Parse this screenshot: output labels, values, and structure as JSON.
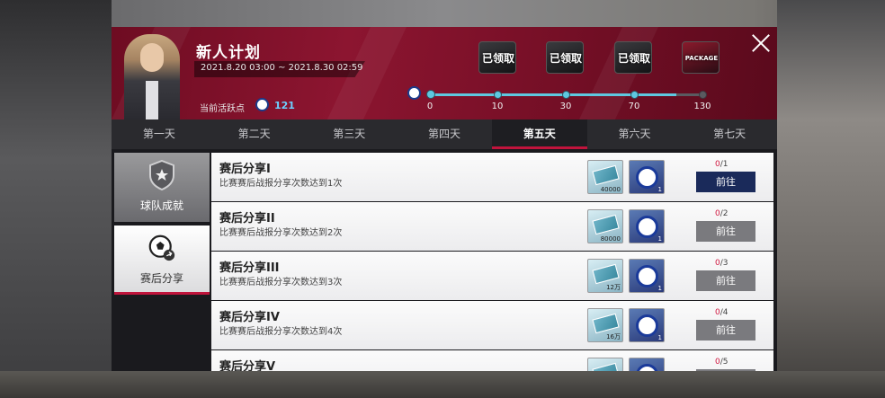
{
  "event": {
    "title": "新人计划",
    "date_range": "2021.8.20 03:00 ~ 2021.8.30 02:59",
    "activity_label": "当前活跃点",
    "activity_value": "121"
  },
  "rewards_track": {
    "milestones": [
      {
        "value": "0"
      },
      {
        "value": "10",
        "box_label": "已领取"
      },
      {
        "value": "30",
        "box_label": "已领取"
      },
      {
        "value": "70",
        "box_label": "已领取"
      },
      {
        "value": "130",
        "box_label": "PACKAGE"
      }
    ],
    "progress_fraction": 0.9,
    "accent_color": "#5ec8e0"
  },
  "tabs": [
    {
      "label": "第一天"
    },
    {
      "label": "第二天"
    },
    {
      "label": "第三天"
    },
    {
      "label": "第四天"
    },
    {
      "label": "第五天",
      "active": true
    },
    {
      "label": "第六天"
    },
    {
      "label": "第七天"
    }
  ],
  "sidebar": {
    "items": [
      {
        "label": "球队成就",
        "icon": "shield-star-icon",
        "active": false
      },
      {
        "label": "赛后分享",
        "icon": "soccer-ball-share-icon",
        "active": true
      }
    ]
  },
  "tasks": [
    {
      "name": "赛后分享I",
      "desc": "比赛赛后战报分享次数达到1次",
      "reward_cash": "40000",
      "reward_item_count": "1",
      "progress_current": "0",
      "progress_total": "/1",
      "button": "前往",
      "button_state": "primary"
    },
    {
      "name": "赛后分享II",
      "desc": "比赛赛后战报分享次数达到2次",
      "reward_cash": "80000",
      "reward_item_count": "1",
      "progress_current": "0",
      "progress_total": "/2",
      "button": "前往",
      "button_state": "disabled"
    },
    {
      "name": "赛后分享III",
      "desc": "比赛赛后战报分享次数达到3次",
      "reward_cash": "12万",
      "reward_item_count": "1",
      "progress_current": "0",
      "progress_total": "/3",
      "button": "前往",
      "button_state": "disabled"
    },
    {
      "name": "赛后分享IV",
      "desc": "比赛赛后战报分享次数达到4次",
      "reward_cash": "16万",
      "reward_item_count": "1",
      "progress_current": "0",
      "progress_total": "/4",
      "button": "前往",
      "button_state": "disabled"
    },
    {
      "name": "赛后分享V",
      "desc": "",
      "reward_cash": "",
      "reward_item_count": "",
      "progress_current": "0",
      "progress_total": "/5",
      "button": "",
      "button_state": "disabled"
    }
  ],
  "colors": {
    "header": "#8c1530",
    "active_tab_underline": "#c0143c",
    "progress_current": "#d01840",
    "primary_button": "#1a2a5a"
  }
}
